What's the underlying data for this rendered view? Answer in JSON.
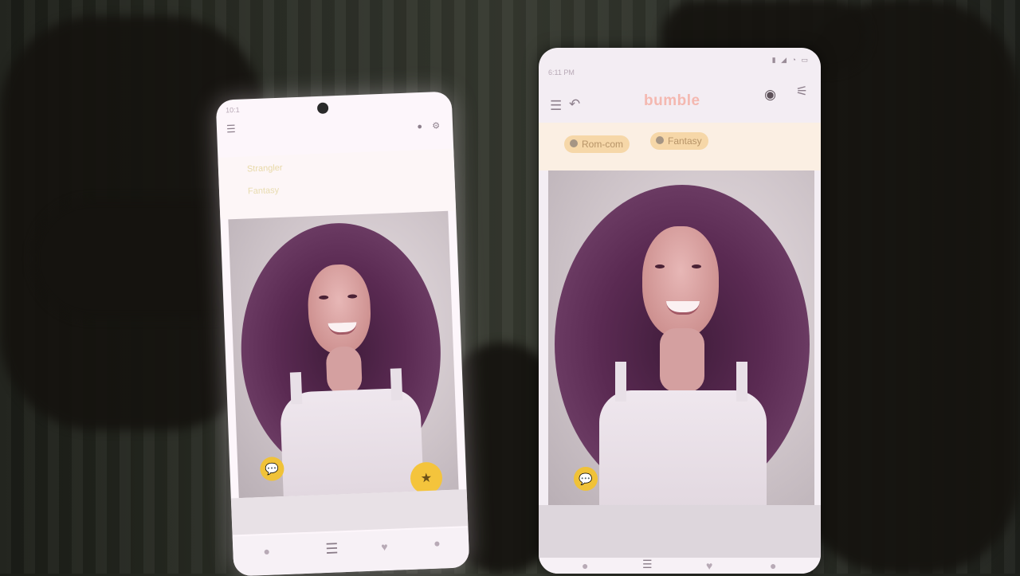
{
  "scene": {
    "description_type": "photo of two smartphones held side by side"
  },
  "phone_left": {
    "status_time": "10:1",
    "header_icons": [
      "menu-icon",
      "app-icon",
      "filter-icon"
    ],
    "tags": [
      "Strangler",
      "Fantasy"
    ],
    "action_icons": [
      "chat-icon",
      "star-icon"
    ],
    "nav_icons": [
      "profile-icon",
      "swipe-icon",
      "heart-icon",
      "chat-icon"
    ]
  },
  "phone_right": {
    "status_time": "6:11 PM",
    "logo": "bumble",
    "header_icons": [
      "menu-icon",
      "undo-icon",
      "incognito-icon",
      "filter-icon"
    ],
    "tags": [
      "Rom-com",
      "Fantasy"
    ],
    "action_icons": [
      "chat-icon",
      "star-icon"
    ],
    "nav_icons": [
      "profile-icon",
      "swipe-icon",
      "heart-icon",
      "chat-icon"
    ]
  },
  "colors": {
    "accent": "#f4c43c",
    "logo": "#f4b8b0",
    "tag_bg": "#f6d7a8",
    "hair": "#5a2a52"
  }
}
